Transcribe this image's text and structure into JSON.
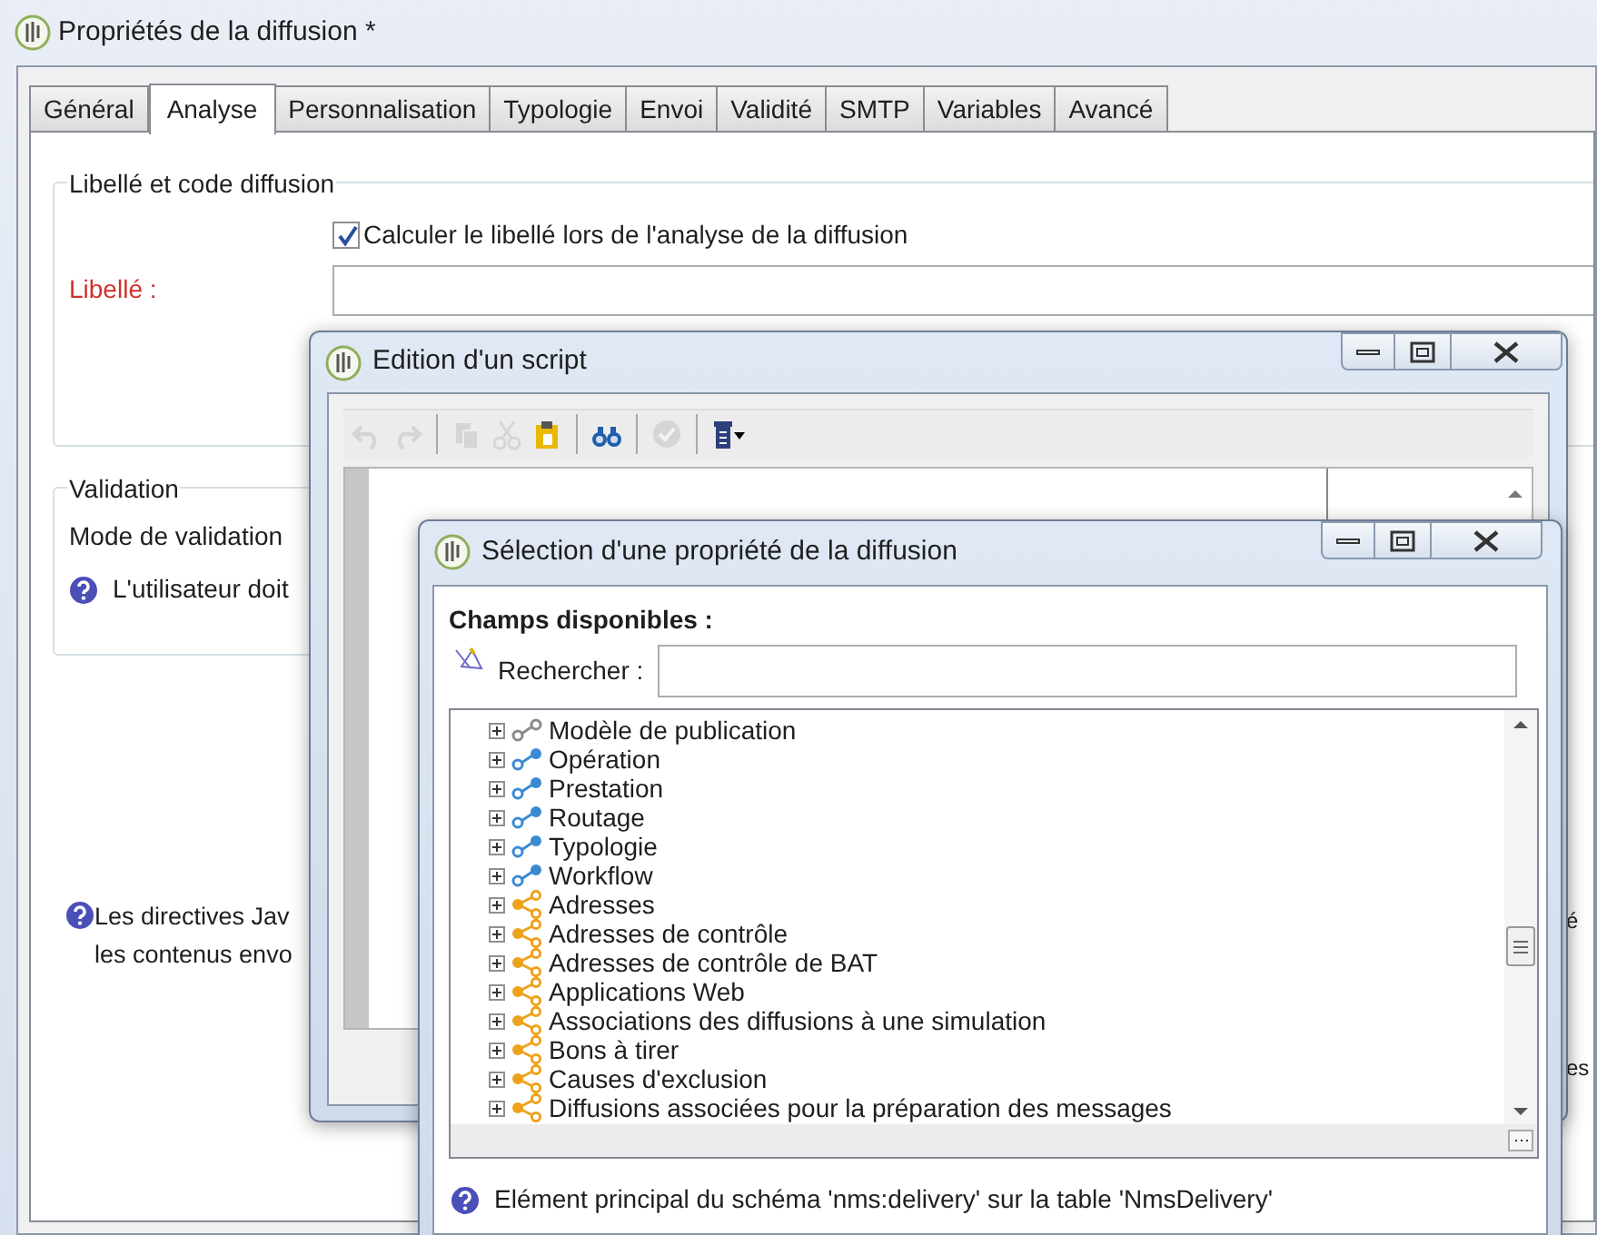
{
  "main_window": {
    "title": "Propriétés de la diffusion *",
    "tabs": [
      {
        "label": "Général",
        "selected": false
      },
      {
        "label": "Analyse",
        "selected": true
      },
      {
        "label": "Personnalisation",
        "selected": false
      },
      {
        "label": "Typologie",
        "selected": false
      },
      {
        "label": "Envoi",
        "selected": false
      },
      {
        "label": "Validité",
        "selected": false
      },
      {
        "label": "SMTP",
        "selected": false
      },
      {
        "label": "Variables",
        "selected": false
      },
      {
        "label": "Avancé",
        "selected": false
      }
    ],
    "label_group": {
      "title": "Libellé et code diffusion",
      "checkbox": {
        "label": "Calculer le libellé lors de l'analyse de la diffusion",
        "checked": true
      },
      "field_label": "Libellé :"
    },
    "validation_group": {
      "title": "Validation",
      "mode_label": "Mode de validation",
      "help": "L'utilisateur doit"
    },
    "help_lines": [
      "Les directives Jav",
      "les contenus envo"
    ],
    "edge_fragments": [
      "é",
      "es"
    ]
  },
  "script_window": {
    "title": "Edition d'un script",
    "toolbar": [
      {
        "kind": "undo",
        "disabled": true
      },
      {
        "kind": "redo",
        "disabled": true
      },
      {
        "kind": "sep"
      },
      {
        "kind": "copy",
        "disabled": true
      },
      {
        "kind": "cut",
        "disabled": true
      },
      {
        "kind": "paste",
        "disabled": false
      },
      {
        "kind": "sep"
      },
      {
        "kind": "find",
        "disabled": false
      },
      {
        "kind": "sep"
      },
      {
        "kind": "check",
        "disabled": true
      },
      {
        "kind": "sep"
      },
      {
        "kind": "menu",
        "disabled": false
      }
    ]
  },
  "select_window": {
    "title": "Sélection d'une propriété de la diffusion",
    "heading": "Champs disponibles :",
    "search_label": "Rechercher :",
    "tree": [
      {
        "label": "Modèle de publication",
        "kind": "inactive-link"
      },
      {
        "label": "Opération",
        "kind": "link"
      },
      {
        "label": "Prestation",
        "kind": "link"
      },
      {
        "label": "Routage",
        "kind": "link"
      },
      {
        "label": "Typologie",
        "kind": "link"
      },
      {
        "label": "Workflow",
        "kind": "link"
      },
      {
        "label": "Adresses",
        "kind": "collection"
      },
      {
        "label": "Adresses de contrôle",
        "kind": "collection"
      },
      {
        "label": "Adresses de contrôle de BAT",
        "kind": "collection"
      },
      {
        "label": "Applications Web",
        "kind": "collection"
      },
      {
        "label": "Associations des diffusions à une simulation",
        "kind": "collection"
      },
      {
        "label": "Bons à tirer",
        "kind": "collection"
      },
      {
        "label": "Causes d'exclusion",
        "kind": "collection"
      },
      {
        "label": "Diffusions associées pour la préparation des messages",
        "kind": "collection"
      }
    ],
    "help": "Elément principal du schéma 'nms:delivery' sur la table 'NmsDelivery'"
  }
}
